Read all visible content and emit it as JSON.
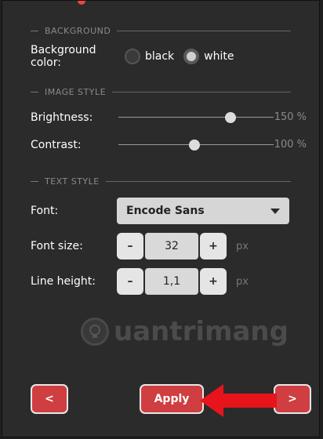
{
  "background": {
    "section_label": "BACKGROUND",
    "label": "Background color:",
    "options": [
      {
        "label": "black",
        "selected": false
      },
      {
        "label": "white",
        "selected": true
      }
    ]
  },
  "image_style": {
    "section_label": "IMAGE STYLE",
    "brightness": {
      "label": "Brightness:",
      "value_text": "150 %",
      "fraction": 0.72
    },
    "contrast": {
      "label": "Contrast:",
      "value_text": "100 %",
      "fraction": 0.49
    }
  },
  "text_style": {
    "section_label": "TEXT STYLE",
    "font": {
      "label": "Font:",
      "value": "Encode Sans"
    },
    "font_size": {
      "label": "Font size:",
      "value": "32",
      "minus": "–",
      "plus": "+",
      "unit": "px"
    },
    "line_height": {
      "label": "Line height:",
      "value": "1,1",
      "minus": "–",
      "plus": "+",
      "unit": "px"
    }
  },
  "watermark": {
    "text": "uantrimang"
  },
  "footer": {
    "prev": "<",
    "apply": "Apply",
    "next": ">"
  },
  "colors": {
    "accent": "#cf3e41",
    "arrow": "#e8141b"
  }
}
